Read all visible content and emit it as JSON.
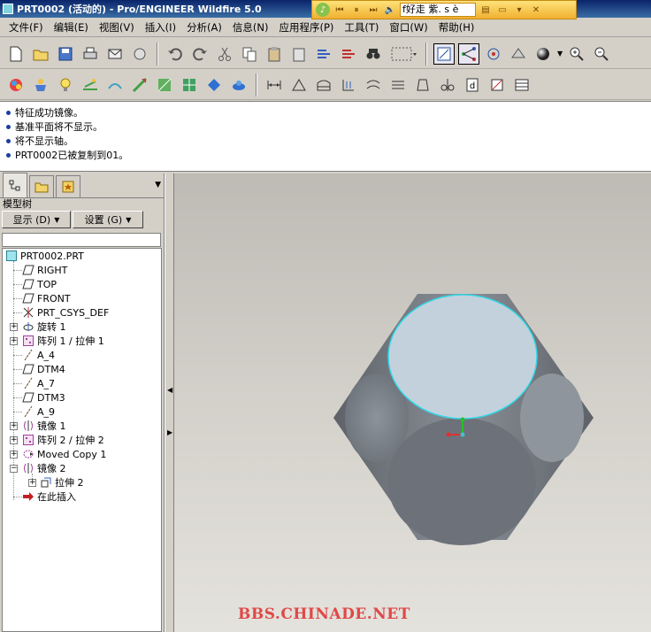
{
  "window": {
    "title": "PRT0002 (活动的) - Pro/ENGINEER Wildfire 5.0"
  },
  "media_player": {
    "song": "f好走  紫. s è"
  },
  "menu": {
    "items": [
      "文件(F)",
      "编辑(E)",
      "视图(V)",
      "插入(I)",
      "分析(A)",
      "信息(N)",
      "应用程序(P)",
      "工具(T)",
      "窗口(W)",
      "帮助(H)"
    ]
  },
  "messages": [
    "特征成功镜像。",
    "基准平面将不显示。",
    "将不显示轴。",
    "PRT0002已被复制到01。"
  ],
  "panel": {
    "title": "模型树",
    "show_button": "显示 (D)",
    "settings_button": "设置 (G)"
  },
  "tree": {
    "root": "PRT0002.PRT",
    "items": [
      {
        "label": "RIGHT",
        "icon": "datum-plane-icon"
      },
      {
        "label": "TOP",
        "icon": "datum-plane-icon"
      },
      {
        "label": "FRONT",
        "icon": "datum-plane-icon"
      },
      {
        "label": "PRT_CSYS_DEF",
        "icon": "csys-icon"
      },
      {
        "label": "旋转 1",
        "icon": "revolve-icon"
      },
      {
        "label": "阵列 1 / 拉伸 1",
        "icon": "pattern-icon"
      },
      {
        "label": "A_4",
        "icon": "axis-icon"
      },
      {
        "label": "DTM4",
        "icon": "datum-plane-icon"
      },
      {
        "label": "A_7",
        "icon": "axis-icon"
      },
      {
        "label": "DTM3",
        "icon": "datum-plane-icon"
      },
      {
        "label": "A_9",
        "icon": "axis-icon"
      },
      {
        "label": "镜像 1",
        "icon": "mirror-icon"
      },
      {
        "label": "阵列 2 / 拉伸 2",
        "icon": "pattern-icon"
      },
      {
        "label": "Moved Copy 1",
        "icon": "moved-copy-icon"
      },
      {
        "label": "镜像 2",
        "icon": "mirror-icon"
      },
      {
        "label": "拉伸 2",
        "icon": "extrude-icon"
      },
      {
        "label": "在此插入",
        "icon": "insert-arrow-icon"
      }
    ]
  },
  "viewport": {
    "watermark": "BBS.CHINADE.NET"
  },
  "colors": {
    "viewport_top": "#bdbbb4",
    "viewport_bottom": "#e4e2dc",
    "highlight_edge": "#30d8e8",
    "watermark": "#e04848"
  }
}
